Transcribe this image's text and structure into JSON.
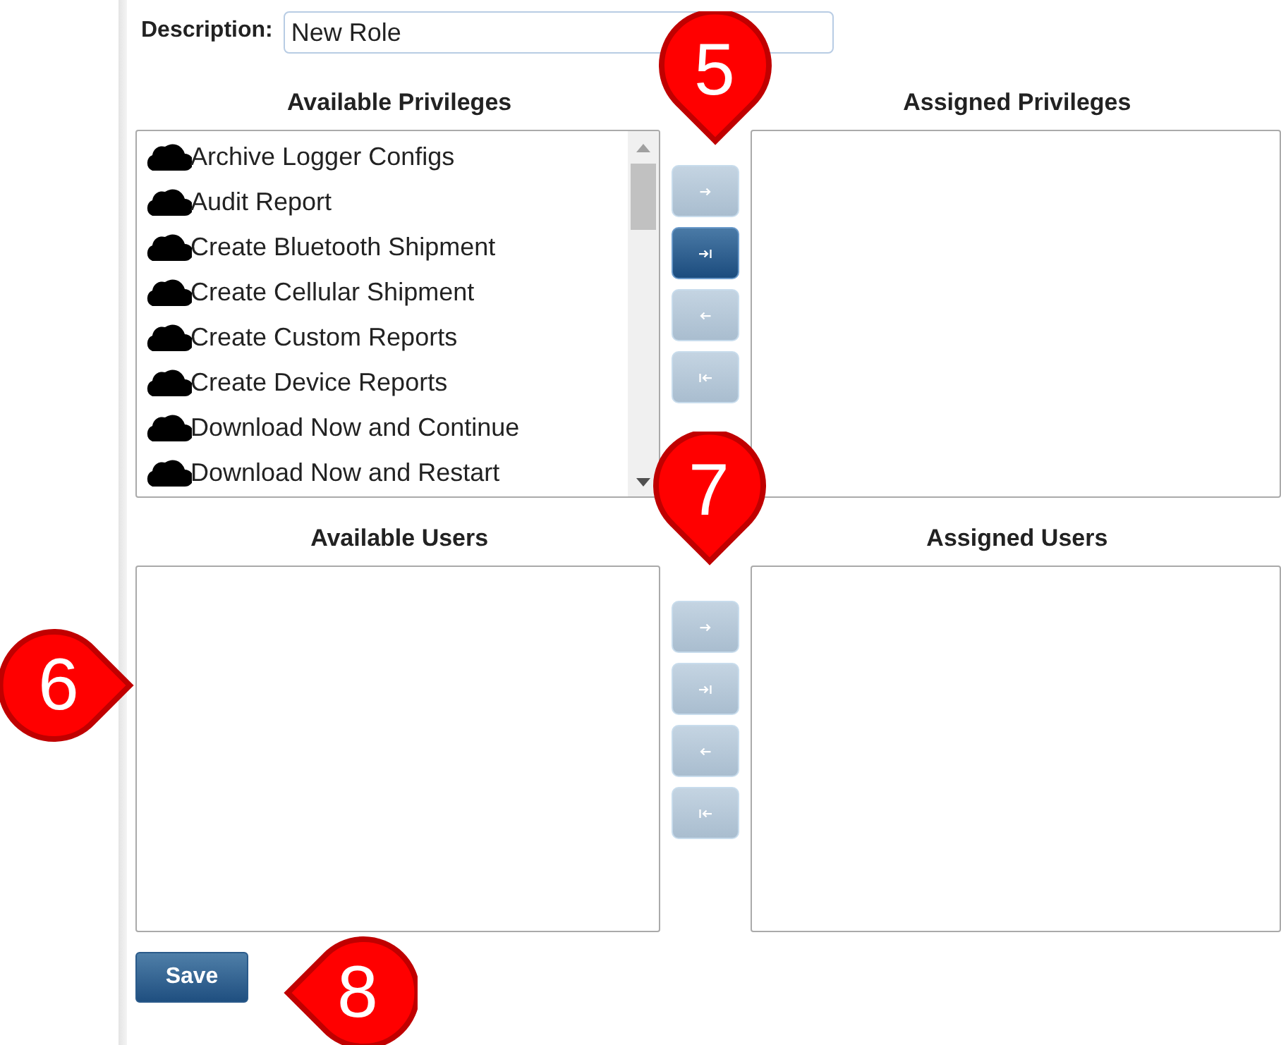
{
  "description": {
    "label": "Description:",
    "value": "New Role"
  },
  "privileges": {
    "available_title": "Available Privileges",
    "assigned_title": "Assigned Privileges",
    "available": [
      {
        "label": "Archive Logger Configs"
      },
      {
        "label": "Audit Report"
      },
      {
        "label": "Create Bluetooth Shipment"
      },
      {
        "label": "Create Cellular Shipment"
      },
      {
        "label": "Create Custom Reports"
      },
      {
        "label": "Create Device Reports"
      },
      {
        "label": "Download Now and Continue"
      },
      {
        "label": "Download Now and Restart"
      }
    ],
    "buttons": [
      {
        "kind": "move-right",
        "disabled": true
      },
      {
        "kind": "move-all-right",
        "disabled": false
      },
      {
        "kind": "move-left",
        "disabled": true
      },
      {
        "kind": "move-all-left",
        "disabled": true
      }
    ]
  },
  "users": {
    "available_title": "Available Users",
    "assigned_title": "Assigned Users",
    "buttons": [
      {
        "kind": "move-right",
        "disabled": true
      },
      {
        "kind": "move-all-right",
        "disabled": true
      },
      {
        "kind": "move-left",
        "disabled": true
      },
      {
        "kind": "move-all-left",
        "disabled": true
      }
    ]
  },
  "save_button": "Save",
  "callouts": [
    {
      "number": "5",
      "kind": "point-down"
    },
    {
      "number": "7",
      "kind": "point-down"
    },
    {
      "number": "6",
      "kind": "point-right"
    },
    {
      "number": "8",
      "kind": "point-left"
    }
  ]
}
